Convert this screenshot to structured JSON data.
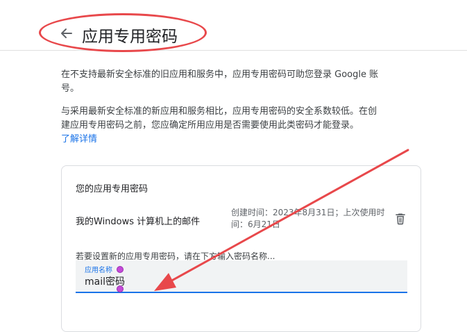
{
  "header": {
    "title": "应用专用密码",
    "back_icon": "arrow-left-icon"
  },
  "intro": {
    "paragraph1": "在不支持最新安全标准的旧应用和服务中，应用专用密码可助您登录 Google 账号。",
    "paragraph2": "与采用最新安全标准的新应用和服务相比，应用专用密码的安全系数较低。在创建应用专用密码之前，您应确定所用应用是否需要使用此类密码才能登录。",
    "learn_more": "了解详情"
  },
  "card": {
    "title": "您的应用专用密码",
    "app_password": {
      "name": "我的Windows 计算机上的邮件",
      "meta": "创建时间：2023年8月31日；上次使用时间：6月21日",
      "delete_icon": "trash-icon"
    },
    "create_hint": "若要设置新的应用专用密码，请在下方输入密码名称...",
    "input": {
      "label": "应用名称",
      "value": "mail密码"
    }
  },
  "colors": {
    "accent": "#1a73e8",
    "annotation": "#e8484b",
    "selection_handle": "#c44ad8"
  }
}
